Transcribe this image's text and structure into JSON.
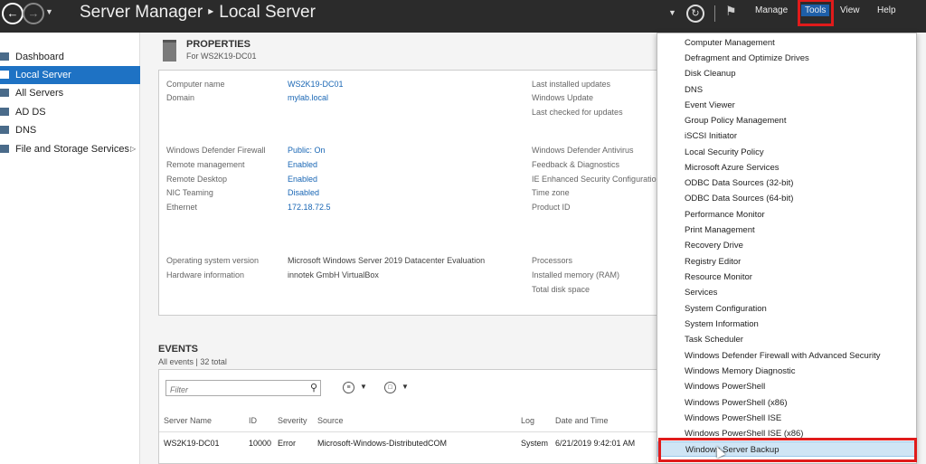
{
  "app": {
    "title": "Server Manager",
    "breadcrumb_sep": "▸",
    "page": "Local Server"
  },
  "toolbar": {
    "back_icon": "back-arrow-icon",
    "forward_icon": "forward-arrow-icon",
    "refresh_icon": "refresh-icon",
    "flag_icon": "notifications-flag-icon",
    "menus": [
      "Manage",
      "Tools",
      "View",
      "Help"
    ]
  },
  "sidebar": {
    "items": [
      {
        "label": "Dashboard",
        "icon": "dashboard-icon"
      },
      {
        "label": "Local Server",
        "icon": "server-icon",
        "active": true
      },
      {
        "label": "All Servers",
        "icon": "servers-icon"
      },
      {
        "label": "AD DS",
        "icon": "adds-icon"
      },
      {
        "label": "DNS",
        "icon": "dns-icon"
      },
      {
        "label": "File and Storage Services",
        "icon": "storage-icon",
        "expand": "▷"
      }
    ]
  },
  "properties": {
    "heading": "PROPERTIES",
    "sub": "For WS2K19-DC01",
    "left": [
      {
        "label": "Computer name",
        "value": "WS2K19-DC01"
      },
      {
        "label": "Domain",
        "value": "mylab.local"
      },
      {
        "label": "Windows Defender Firewall",
        "value": "Public: On"
      },
      {
        "label": "Remote management",
        "value": "Enabled"
      },
      {
        "label": "Remote Desktop",
        "value": "Enabled"
      },
      {
        "label": "NIC Teaming",
        "value": "Disabled"
      },
      {
        "label": "Ethernet",
        "value": "172.18.72.5"
      },
      {
        "label": "Operating system version",
        "value": "Microsoft Windows Server 2019 Datacenter Evaluation"
      },
      {
        "label": "Hardware information",
        "value": "innotek GmbH VirtualBox"
      }
    ],
    "right": [
      "Last installed updates",
      "Windows Update",
      "Last checked for updates",
      "Windows Defender Antivirus",
      "Feedback & Diagnostics",
      "IE Enhanced Security Configuratio",
      "Time zone",
      "Product ID",
      "Processors",
      "Installed memory (RAM)",
      "Total disk space"
    ]
  },
  "events": {
    "heading": "EVENTS",
    "sub": "All events | 32 total",
    "filter_placeholder": "Filter",
    "columns": [
      "Server Name",
      "ID",
      "Severity",
      "Source",
      "Log",
      "Date and Time"
    ],
    "rows": [
      [
        "WS2K19-DC01",
        "10000",
        "Error",
        "Microsoft-Windows-DistributedCOM",
        "System",
        "6/21/2019 9:42:01 AM"
      ]
    ]
  },
  "tools_menu": {
    "items": [
      "Computer Management",
      "Defragment and Optimize Drives",
      "Disk Cleanup",
      "DNS",
      "Event Viewer",
      "Group Policy Management",
      "iSCSI Initiator",
      "Local Security Policy",
      "Microsoft Azure Services",
      "ODBC Data Sources (32-bit)",
      "ODBC Data Sources (64-bit)",
      "Performance Monitor",
      "Print Management",
      "Recovery Drive",
      "Registry Editor",
      "Resource Monitor",
      "Services",
      "System Configuration",
      "System Information",
      "Task Scheduler",
      "Windows Defender Firewall with Advanced Security",
      "Windows Memory Diagnostic",
      "Windows PowerShell",
      "Windows PowerShell (x86)",
      "Windows PowerShell ISE",
      "Windows PowerShell ISE (x86)",
      "Windows Server Backup"
    ],
    "highlighted": "Windows Server Backup"
  },
  "colors": {
    "topbar": "#2b2b2b",
    "accent": "#1e72c4",
    "highlight_box": "#e01b1b",
    "menu_hover": "#cfe5f5"
  }
}
